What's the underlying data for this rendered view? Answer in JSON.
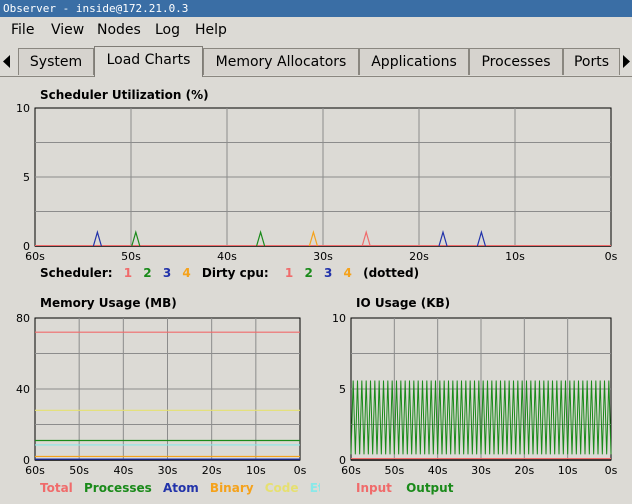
{
  "window": {
    "title": "Observer - inside@172.21.0.3"
  },
  "menu": [
    "File",
    "View",
    "Nodes",
    "Log",
    "Help"
  ],
  "tabs": [
    "System",
    "Load Charts",
    "Memory Allocators",
    "Applications",
    "Processes",
    "Ports"
  ],
  "active_tab": "Load Charts",
  "colors": {
    "c1": "#f06b6b",
    "c2": "#1a8a1a",
    "c3": "#2233aa",
    "c4": "#f5a21b",
    "code": "#e6e070",
    "ets": "#8ae8e8",
    "grid": "#8c8c8c",
    "axis_bg": "#dcdad5"
  },
  "scheduler_legend": {
    "scheduler_label": "Scheduler:",
    "scheduler_ids": [
      "1",
      "2",
      "3",
      "4"
    ],
    "dirty_label": "Dirty cpu:",
    "dirty_ids": [
      "1",
      "2",
      "3",
      "4"
    ],
    "dotted_label": "(dotted)"
  },
  "memory_legend": [
    "Total",
    "Processes",
    "Atom",
    "Binary",
    "Code",
    "Ets"
  ],
  "io_legend": [
    "Input",
    "Output"
  ],
  "chart_data": [
    {
      "id": "scheduler",
      "type": "line",
      "title": "Scheduler Utilization (%)",
      "xlabel": "",
      "ylabel": "",
      "x_ticks": [
        "60s",
        "50s",
        "40s",
        "30s",
        "20s",
        "10s",
        "0s"
      ],
      "y_ticks": [
        "0",
        "5",
        "10"
      ],
      "ylim": [
        0,
        10
      ],
      "xlim": [
        60,
        0
      ],
      "grid": true,
      "series": [
        {
          "name": "1",
          "color_key": "c1",
          "peaks": [
            [
              25.5,
              1.0
            ]
          ]
        },
        {
          "name": "2",
          "color_key": "c2",
          "peaks": [
            [
              49.5,
              1.0
            ],
            [
              36.5,
              1.0
            ]
          ]
        },
        {
          "name": "3",
          "color_key": "c3",
          "peaks": [
            [
              53.5,
              1.0
            ],
            [
              17.5,
              1.0
            ],
            [
              13.5,
              1.0
            ]
          ]
        },
        {
          "name": "4",
          "color_key": "c4",
          "peaks": [
            [
              31.0,
              1.0
            ]
          ]
        }
      ]
    },
    {
      "id": "memory",
      "type": "line",
      "title": "Memory Usage (MB)",
      "xlabel": "",
      "ylabel": "",
      "x_ticks": [
        "60s",
        "50s",
        "40s",
        "30s",
        "20s",
        "10s",
        "0s"
      ],
      "y_ticks": [
        "0",
        "40",
        "80"
      ],
      "ylim": [
        0,
        80
      ],
      "xlim": [
        60,
        0
      ],
      "grid": true,
      "series": [
        {
          "name": "Total",
          "color_key": "c1",
          "value": 72
        },
        {
          "name": "Processes",
          "color_key": "c2",
          "value": 11
        },
        {
          "name": "Atom",
          "color_key": "c3",
          "value": 0.5
        },
        {
          "name": "Binary",
          "color_key": "c4",
          "value": 2
        },
        {
          "name": "Code",
          "color_key": "code",
          "value": 28
        },
        {
          "name": "Ets",
          "color_key": "ets",
          "value": 8.5
        }
      ]
    },
    {
      "id": "io",
      "type": "line",
      "title": "IO Usage (KB)",
      "xlabel": "",
      "ylabel": "",
      "x_ticks": [
        "60s",
        "50s",
        "40s",
        "30s",
        "20s",
        "10s",
        "0s"
      ],
      "y_ticks": [
        "0",
        "5",
        "10"
      ],
      "ylim": [
        0,
        10
      ],
      "xlim": [
        60,
        0
      ],
      "grid": true,
      "series": [
        {
          "name": "Input",
          "color_key": "c1",
          "value": 0.1
        },
        {
          "name": "Output",
          "color_key": "c2",
          "oscillation": {
            "low": 0.4,
            "high": 5.6,
            "period_s": 1.0
          }
        }
      ]
    }
  ]
}
